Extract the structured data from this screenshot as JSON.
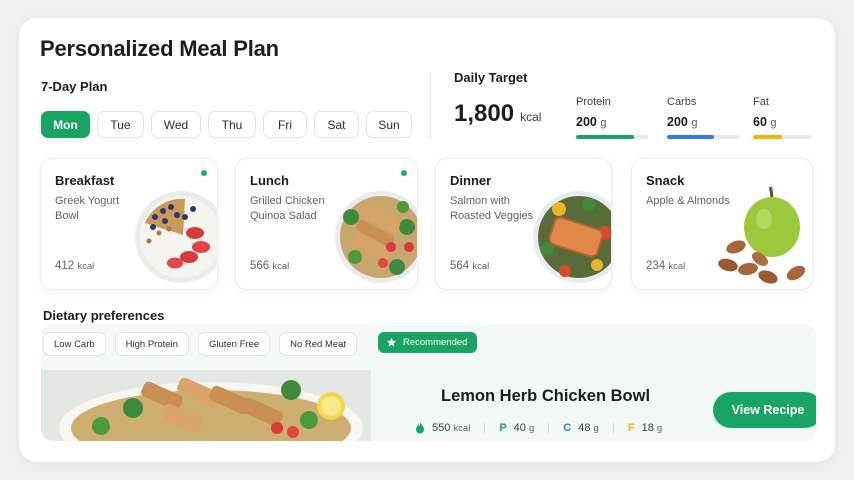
{
  "header": {
    "title": "Personalized Meal Plan"
  },
  "plan": {
    "label": "7-Day Plan",
    "days": [
      "Mon",
      "Tue",
      "Wed",
      "Thu",
      "Fri",
      "Sat",
      "Sun"
    ],
    "selected": "Mon"
  },
  "target": {
    "label": "Daily Target",
    "value": "1,800",
    "unit": "kcal",
    "macros": [
      {
        "name": "Protein",
        "value": "200",
        "unit": "g",
        "progress": 0.8,
        "color": "#1aa463"
      },
      {
        "name": "Carbs",
        "value": "200",
        "unit": "g",
        "progress": 0.65,
        "color": "#2f7bea"
      },
      {
        "name": "Fat",
        "value": "60",
        "unit": "g",
        "progress": 0.5,
        "color": "#f4b400"
      }
    ]
  },
  "meals": [
    {
      "title": "Breakfast",
      "desc": "Greek Yogurt Bowl",
      "kcal": "412",
      "unit": "kcal",
      "image": "yogurt-bowl"
    },
    {
      "title": "Lunch",
      "desc": "Grilled Chicken Quinoa Salad",
      "kcal": "566",
      "unit": "kcal",
      "image": "chicken-quinoa-salad"
    },
    {
      "title": "Dinner",
      "desc": "Salmon with Roasted Veggies",
      "kcal": "564",
      "unit": "kcal",
      "image": "salmon-veggies"
    },
    {
      "title": "Snack",
      "desc": "Apple & Almonds",
      "kcal": "234",
      "unit": "kcal",
      "image": "apple-almonds"
    }
  ],
  "dietary": {
    "label": "Dietary preferences",
    "chips": [
      "Low Carb",
      "High Protein",
      "Gluten Free",
      "No Red Meat"
    ]
  },
  "recommended": {
    "badge": "Recommended",
    "title": "Lemon Herb Chicken Bowl",
    "kcal": "550",
    "kcal_unit": "kcal",
    "protein_letter": "P",
    "protein": "40",
    "carbs_letter": "C",
    "carbs": "48",
    "fat_letter": "F",
    "fat": "18",
    "gram_unit": "g",
    "button": "View Recipe"
  },
  "colors": {
    "accent": "#1aa463",
    "protein": "#1aa463",
    "carbs": "#2f7bea",
    "fat": "#f4b400"
  }
}
